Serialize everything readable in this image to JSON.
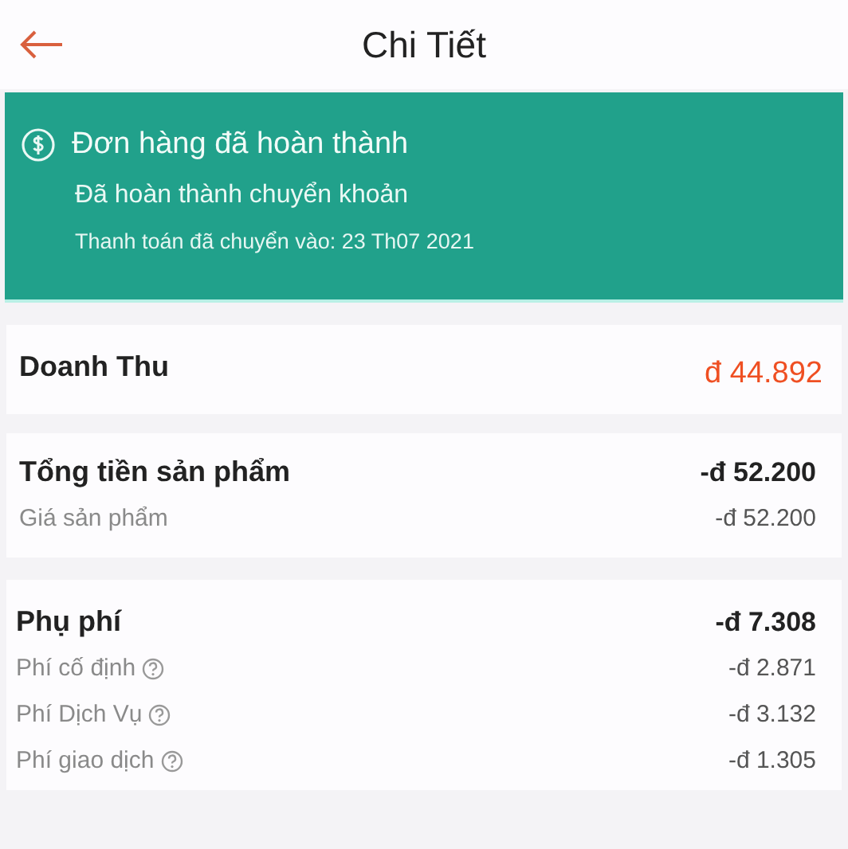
{
  "header": {
    "title": "Chi Tiết"
  },
  "status_banner": {
    "title": "Đơn hàng đã hoàn thành",
    "subtitle": "Đã hoàn thành chuyển khoản",
    "note": "Thanh toán đã chuyển vào: 23 Th07 2021"
  },
  "revenue": {
    "label": "Doanh Thu",
    "amount": "đ 44.892"
  },
  "sections": [
    {
      "title": "Tổng tiền sản phẩm",
      "total": "-đ 52.200",
      "items": [
        {
          "label": "Giá sản phẩm",
          "amount": "-đ 52.200",
          "help": false
        }
      ]
    },
    {
      "title": "Phụ phí",
      "total": "-đ 7.308",
      "items": [
        {
          "label": "Phí cố định",
          "amount": "-đ 2.871",
          "help": true
        },
        {
          "label": "Phí Dịch Vụ",
          "amount": "-đ 3.132",
          "help": true
        },
        {
          "label": "Phí giao dịch",
          "amount": "-đ 1.305",
          "help": true
        }
      ]
    }
  ]
}
